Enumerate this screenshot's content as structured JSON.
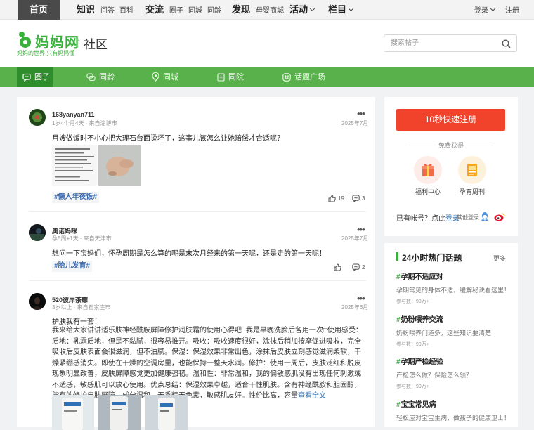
{
  "topnav": {
    "home": "首页",
    "groups": [
      {
        "label": "知识",
        "subs": [
          "问答",
          "百科"
        ]
      },
      {
        "label": "交流",
        "subs": [
          "圈子",
          "同城",
          "同龄"
        ]
      },
      {
        "label": "发现",
        "subs": [
          "母婴商城"
        ]
      },
      {
        "label": "活动",
        "subs": []
      },
      {
        "label": "栏目",
        "subs": []
      }
    ],
    "login": "登录",
    "register": "注册"
  },
  "header": {
    "logo_text": "妈妈网",
    "logo_slogan": "妈妈的世界 只有妈妈懂",
    "separator": "·",
    "section": "社区",
    "search_placeholder": "搜索帖子"
  },
  "greenbar": {
    "tabs": [
      {
        "label": "圈子",
        "icon": "chat-bubble-icon",
        "active": true
      },
      {
        "label": "同龄",
        "icon": "chat-double-icon",
        "active": false
      },
      {
        "label": "同城",
        "icon": "location-pin-icon",
        "active": false
      },
      {
        "label": "同院",
        "icon": "hospital-icon",
        "active": false
      },
      {
        "label": "话题广场",
        "icon": "hash-icon",
        "active": false
      }
    ]
  },
  "posts": [
    {
      "author": "168yanyan711",
      "meta": "1岁4个月4天 · 来自淄博市",
      "date": "2025年7月",
      "title": "月嫂做饭时不小心把大理石台面烫坏了，这事儿该怎么让她赔偿才合适呢？",
      "tag": "#懒人年夜饭#",
      "likes": "19",
      "comments": "3"
    },
    {
      "author": "奥诺妈咪",
      "meta": "孕5周+1天 · 来自天津市",
      "date": "2025年7月",
      "title": "想问一下宝妈们，怀孕周期是怎么算的呢是末次月经来的第一天呢，还是走的第一天呢！",
      "tag": "#胎儿发育#",
      "likes": "",
      "comments": "2"
    },
    {
      "author": "520彼岸茶蘼",
      "meta": "3岁以上 · 来自石家庄市",
      "date": "2025年6月",
      "title": "护肤我有一套！",
      "body": "我来给大家讲讲适乐肤神经酰胺屏障修护润肤霜的使用心得吧~我是早晚洗脸后各用一次□使用感受：质地：乳霜质地，但是不黏腻，很容易推开。吸收：吸收速度很好，涂抹后稍加按摩促进吸收，完全吸收后皮肤表面会很滋润，但不油腻。保湿：保湿效果非常出色，涂抹后皮肤立刻感觉滋润柔软，干燥紧绷感消失。即使在干燥的空调房里，也能保持一整天水润。修护：使用一周后，皮肤泛红和脱皮现象明显改善，皮肤屏障感觉更加健康强韧。温和性：非常温和，我的偏敏感肌没有出现任何刺激或不适感，敏感肌可以放心使用。优点总结：保湿效果卓越，适合干性肌肤。含有神经酰胺和胆固醇，能有效修护皮肤屏障。成分温和，无香精无色素，敏感肌友好。性价比高，容量",
      "read_more": "查看全文"
    }
  ],
  "sidebar": {
    "register_button": "10秒快速注册",
    "free_get": "免费获得",
    "benefits": [
      {
        "label": "福利中心",
        "icon": "gift-icon"
      },
      {
        "label": "孕育周刊",
        "icon": "magazine-icon"
      }
    ],
    "has_account": "已有帐号？点此",
    "login_link": "登录",
    "other_login": "其他登录",
    "hot_title": "24小时热门话题",
    "hot_more": "更多",
    "hot_topics": [
      {
        "title": "孕期不适应对",
        "desc": "孕期常见的身体不适，缓解秘诀看这里！",
        "count": "参与数：99万+"
      },
      {
        "title": "奶粉喂养交流",
        "desc": "奶粉喂养门道多，这些知识要清楚",
        "count": "参与数：99万+"
      },
      {
        "title": "孕期产检经验",
        "desc": "产检怎么做？保险怎么领？",
        "count": "参与数：99万+"
      },
      {
        "title": "宝宝常见病",
        "desc": "轻松应对宝宝生病，做孩子的健康卫士！",
        "count": ""
      }
    ]
  },
  "colors": {
    "brand_green": "#58b14a",
    "active_green": "#2f8e2b",
    "register_red": "#f1432c",
    "link_blue": "#2d6fb3"
  }
}
